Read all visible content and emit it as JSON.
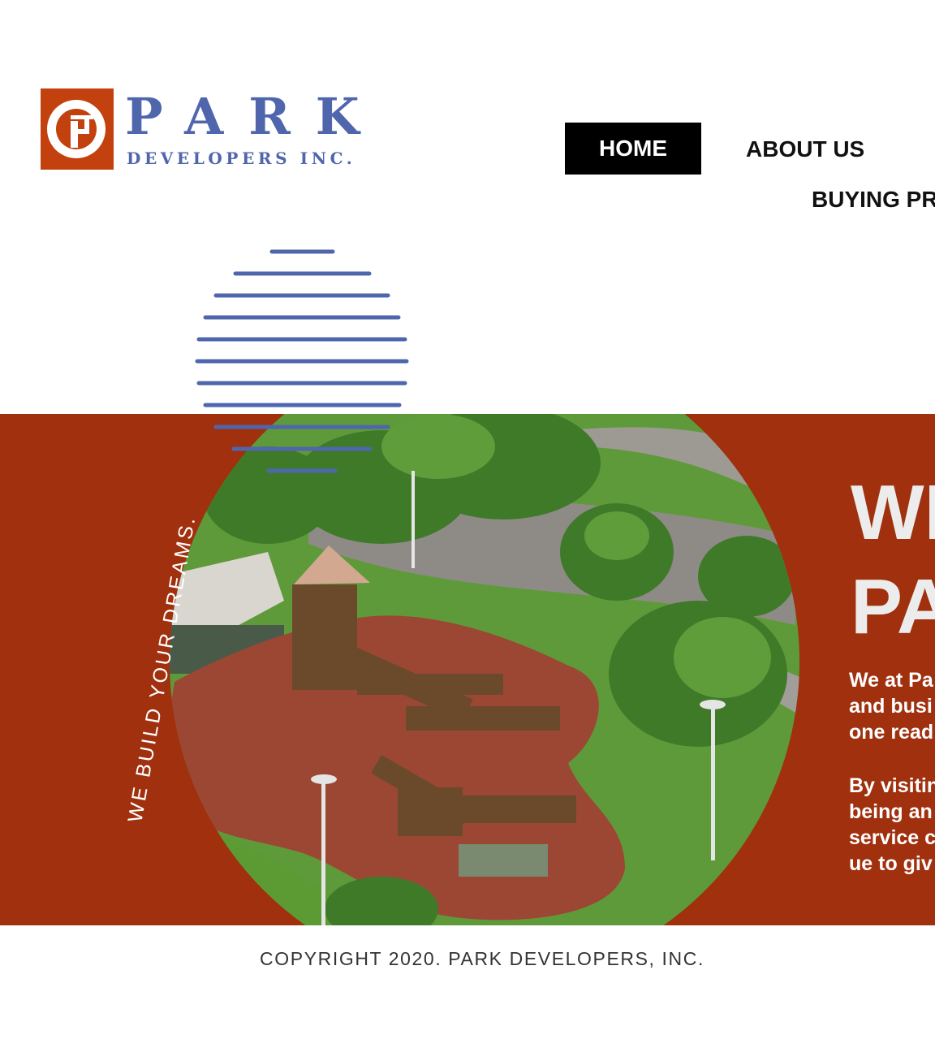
{
  "logo": {
    "wordmark": "PARK",
    "subtitle": "DEVELOPERS INC.",
    "colors": {
      "red": "#c2410e",
      "blue": "#4f66ad"
    }
  },
  "nav": {
    "items": [
      {
        "label": "HOME",
        "active": true
      },
      {
        "label": "ABOUT US",
        "active": false
      },
      {
        "label": "BUYING PR",
        "active": false
      }
    ]
  },
  "hero": {
    "tagline": "WE BUILD YOUR DREAMS.",
    "title_lines": [
      "WE",
      "PA"
    ],
    "paragraph1_lines": [
      "We at Pa",
      "and busi",
      "one read"
    ],
    "paragraph2_lines": [
      "By visitin",
      "being an",
      "service c",
      "ue to giv"
    ],
    "background_color": "#a0300e",
    "photo_description_icon": "playground-photo"
  },
  "footer": {
    "copyright": "COPYRIGHT 2020. PARK DEVELOPERS, INC."
  }
}
